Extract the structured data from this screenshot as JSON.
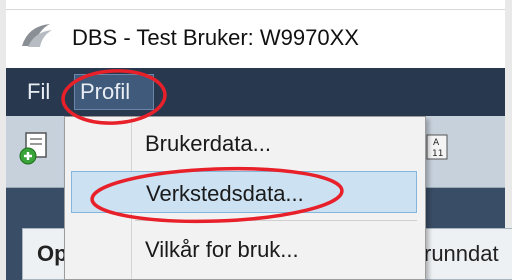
{
  "window": {
    "title": "DBS - Test Bruker: W9970XX"
  },
  "menubar": {
    "items": [
      {
        "label": "Fil"
      },
      {
        "label": "Profil"
      }
    ]
  },
  "dropdown": {
    "items": [
      {
        "label": "Brukerdata..."
      },
      {
        "label": "Verkstedsdata..."
      },
      {
        "label": "Vilkår for bruk..."
      }
    ]
  },
  "tabs": [
    {
      "label": "Op"
    },
    {
      "label": "runndat"
    }
  ],
  "colors": {
    "menubar_bg": "#28394f",
    "highlight": "#cce1f2",
    "annotation": "#e8202a"
  },
  "icons": {
    "app": "app-logo-icon",
    "toolbar_left": "document-add-icon",
    "toolbar_right": "sort-icon"
  }
}
